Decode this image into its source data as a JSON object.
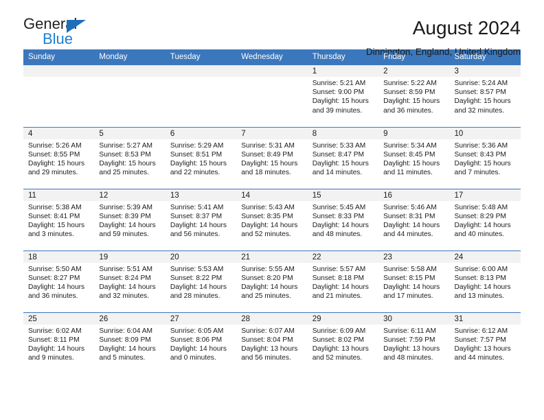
{
  "logo": {
    "primary_text": "General",
    "secondary_text": "Blue",
    "triangle_color": "#1c6fba",
    "secondary_color": "#1c7fd4"
  },
  "header": {
    "title": "August 2024",
    "subtitle": "Dinnington, England, United Kingdom"
  },
  "theme": {
    "header_bar": "#3b77bc",
    "daynum_strip": "#f2f2f2",
    "text": "#1a1a1a"
  },
  "calendar": {
    "weekday_headers": [
      "Sunday",
      "Monday",
      "Tuesday",
      "Wednesday",
      "Thursday",
      "Friday",
      "Saturday"
    ],
    "labels": {
      "sunrise": "Sunrise:",
      "sunset": "Sunset:",
      "daylight": "Daylight:"
    },
    "weeks": [
      [
        {
          "day": "",
          "empty": true
        },
        {
          "day": "",
          "empty": true
        },
        {
          "day": "",
          "empty": true
        },
        {
          "day": "",
          "empty": true
        },
        {
          "day": "1",
          "sunrise": "Sunrise: 5:21 AM",
          "sunset": "Sunset: 9:00 PM",
          "daylight_1": "Daylight: 15 hours",
          "daylight_2": "and 39 minutes."
        },
        {
          "day": "2",
          "sunrise": "Sunrise: 5:22 AM",
          "sunset": "Sunset: 8:59 PM",
          "daylight_1": "Daylight: 15 hours",
          "daylight_2": "and 36 minutes."
        },
        {
          "day": "3",
          "sunrise": "Sunrise: 5:24 AM",
          "sunset": "Sunset: 8:57 PM",
          "daylight_1": "Daylight: 15 hours",
          "daylight_2": "and 32 minutes."
        }
      ],
      [
        {
          "day": "4",
          "sunrise": "Sunrise: 5:26 AM",
          "sunset": "Sunset: 8:55 PM",
          "daylight_1": "Daylight: 15 hours",
          "daylight_2": "and 29 minutes."
        },
        {
          "day": "5",
          "sunrise": "Sunrise: 5:27 AM",
          "sunset": "Sunset: 8:53 PM",
          "daylight_1": "Daylight: 15 hours",
          "daylight_2": "and 25 minutes."
        },
        {
          "day": "6",
          "sunrise": "Sunrise: 5:29 AM",
          "sunset": "Sunset: 8:51 PM",
          "daylight_1": "Daylight: 15 hours",
          "daylight_2": "and 22 minutes."
        },
        {
          "day": "7",
          "sunrise": "Sunrise: 5:31 AM",
          "sunset": "Sunset: 8:49 PM",
          "daylight_1": "Daylight: 15 hours",
          "daylight_2": "and 18 minutes."
        },
        {
          "day": "8",
          "sunrise": "Sunrise: 5:33 AM",
          "sunset": "Sunset: 8:47 PM",
          "daylight_1": "Daylight: 15 hours",
          "daylight_2": "and 14 minutes."
        },
        {
          "day": "9",
          "sunrise": "Sunrise: 5:34 AM",
          "sunset": "Sunset: 8:45 PM",
          "daylight_1": "Daylight: 15 hours",
          "daylight_2": "and 11 minutes."
        },
        {
          "day": "10",
          "sunrise": "Sunrise: 5:36 AM",
          "sunset": "Sunset: 8:43 PM",
          "daylight_1": "Daylight: 15 hours",
          "daylight_2": "and 7 minutes."
        }
      ],
      [
        {
          "day": "11",
          "sunrise": "Sunrise: 5:38 AM",
          "sunset": "Sunset: 8:41 PM",
          "daylight_1": "Daylight: 15 hours",
          "daylight_2": "and 3 minutes."
        },
        {
          "day": "12",
          "sunrise": "Sunrise: 5:39 AM",
          "sunset": "Sunset: 8:39 PM",
          "daylight_1": "Daylight: 14 hours",
          "daylight_2": "and 59 minutes."
        },
        {
          "day": "13",
          "sunrise": "Sunrise: 5:41 AM",
          "sunset": "Sunset: 8:37 PM",
          "daylight_1": "Daylight: 14 hours",
          "daylight_2": "and 56 minutes."
        },
        {
          "day": "14",
          "sunrise": "Sunrise: 5:43 AM",
          "sunset": "Sunset: 8:35 PM",
          "daylight_1": "Daylight: 14 hours",
          "daylight_2": "and 52 minutes."
        },
        {
          "day": "15",
          "sunrise": "Sunrise: 5:45 AM",
          "sunset": "Sunset: 8:33 PM",
          "daylight_1": "Daylight: 14 hours",
          "daylight_2": "and 48 minutes."
        },
        {
          "day": "16",
          "sunrise": "Sunrise: 5:46 AM",
          "sunset": "Sunset: 8:31 PM",
          "daylight_1": "Daylight: 14 hours",
          "daylight_2": "and 44 minutes."
        },
        {
          "day": "17",
          "sunrise": "Sunrise: 5:48 AM",
          "sunset": "Sunset: 8:29 PM",
          "daylight_1": "Daylight: 14 hours",
          "daylight_2": "and 40 minutes."
        }
      ],
      [
        {
          "day": "18",
          "sunrise": "Sunrise: 5:50 AM",
          "sunset": "Sunset: 8:27 PM",
          "daylight_1": "Daylight: 14 hours",
          "daylight_2": "and 36 minutes."
        },
        {
          "day": "19",
          "sunrise": "Sunrise: 5:51 AM",
          "sunset": "Sunset: 8:24 PM",
          "daylight_1": "Daylight: 14 hours",
          "daylight_2": "and 32 minutes."
        },
        {
          "day": "20",
          "sunrise": "Sunrise: 5:53 AM",
          "sunset": "Sunset: 8:22 PM",
          "daylight_1": "Daylight: 14 hours",
          "daylight_2": "and 28 minutes."
        },
        {
          "day": "21",
          "sunrise": "Sunrise: 5:55 AM",
          "sunset": "Sunset: 8:20 PM",
          "daylight_1": "Daylight: 14 hours",
          "daylight_2": "and 25 minutes."
        },
        {
          "day": "22",
          "sunrise": "Sunrise: 5:57 AM",
          "sunset": "Sunset: 8:18 PM",
          "daylight_1": "Daylight: 14 hours",
          "daylight_2": "and 21 minutes."
        },
        {
          "day": "23",
          "sunrise": "Sunrise: 5:58 AM",
          "sunset": "Sunset: 8:15 PM",
          "daylight_1": "Daylight: 14 hours",
          "daylight_2": "and 17 minutes."
        },
        {
          "day": "24",
          "sunrise": "Sunrise: 6:00 AM",
          "sunset": "Sunset: 8:13 PM",
          "daylight_1": "Daylight: 14 hours",
          "daylight_2": "and 13 minutes."
        }
      ],
      [
        {
          "day": "25",
          "sunrise": "Sunrise: 6:02 AM",
          "sunset": "Sunset: 8:11 PM",
          "daylight_1": "Daylight: 14 hours",
          "daylight_2": "and 9 minutes."
        },
        {
          "day": "26",
          "sunrise": "Sunrise: 6:04 AM",
          "sunset": "Sunset: 8:09 PM",
          "daylight_1": "Daylight: 14 hours",
          "daylight_2": "and 5 minutes."
        },
        {
          "day": "27",
          "sunrise": "Sunrise: 6:05 AM",
          "sunset": "Sunset: 8:06 PM",
          "daylight_1": "Daylight: 14 hours",
          "daylight_2": "and 0 minutes."
        },
        {
          "day": "28",
          "sunrise": "Sunrise: 6:07 AM",
          "sunset": "Sunset: 8:04 PM",
          "daylight_1": "Daylight: 13 hours",
          "daylight_2": "and 56 minutes."
        },
        {
          "day": "29",
          "sunrise": "Sunrise: 6:09 AM",
          "sunset": "Sunset: 8:02 PM",
          "daylight_1": "Daylight: 13 hours",
          "daylight_2": "and 52 minutes."
        },
        {
          "day": "30",
          "sunrise": "Sunrise: 6:11 AM",
          "sunset": "Sunset: 7:59 PM",
          "daylight_1": "Daylight: 13 hours",
          "daylight_2": "and 48 minutes."
        },
        {
          "day": "31",
          "sunrise": "Sunrise: 6:12 AM",
          "sunset": "Sunset: 7:57 PM",
          "daylight_1": "Daylight: 13 hours",
          "daylight_2": "and 44 minutes."
        }
      ]
    ]
  }
}
